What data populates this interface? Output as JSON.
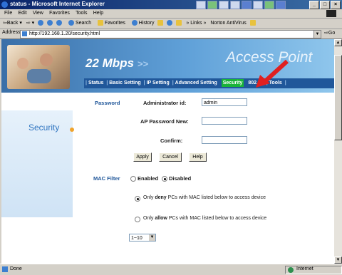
{
  "window": {
    "title": "status - Microsoft Internet Explorer"
  },
  "menu": [
    "File",
    "Edit",
    "View",
    "Favorites",
    "Tools",
    "Help"
  ],
  "toolbar": {
    "back": "Back",
    "search": "Search",
    "favorites": "Favorites",
    "history": "History",
    "links": "Links",
    "norton": "Norton AntiVirus"
  },
  "address": {
    "label": "Address",
    "url": "http://192.168.1.20/security.html",
    "go": "Go"
  },
  "status": {
    "left": "Done",
    "zone": "Internet"
  },
  "header": {
    "speed": "22 Mbps",
    "speed_arrows": ">>",
    "brand": "Access Point",
    "nav": [
      "Status",
      "Basic Setting",
      "IP Setting",
      "Advanced Setting",
      "Security",
      "802.1x",
      "Tools"
    ],
    "active_tab": "Security"
  },
  "sidebar": {
    "section": "Security"
  },
  "form": {
    "password_label": "Password",
    "admin_label": "Administrator id:",
    "admin_value": "admin",
    "ap_password_label": "AP Password New:",
    "confirm_label": "Confirm:",
    "buttons": {
      "apply": "Apply",
      "cancel": "Cancel",
      "help": "Help"
    },
    "mac_label": "MAC Filter",
    "enabled": "Enabled",
    "disabled": "Disabled",
    "mac_state": "Disabled",
    "deny_prefix": "Only",
    "deny_word": "deny",
    "deny_suffix": "PCs with MAC listed below to access device",
    "allow_prefix": "Only",
    "allow_word": "allow",
    "allow_suffix": "PCs with MAC listed below to access device",
    "range_value": "1~10"
  },
  "colors": {
    "nav_bg": "#20579a",
    "active_tab": "#19b339",
    "pointer_arrow": "#e02020",
    "label_blue": "#20579a"
  }
}
